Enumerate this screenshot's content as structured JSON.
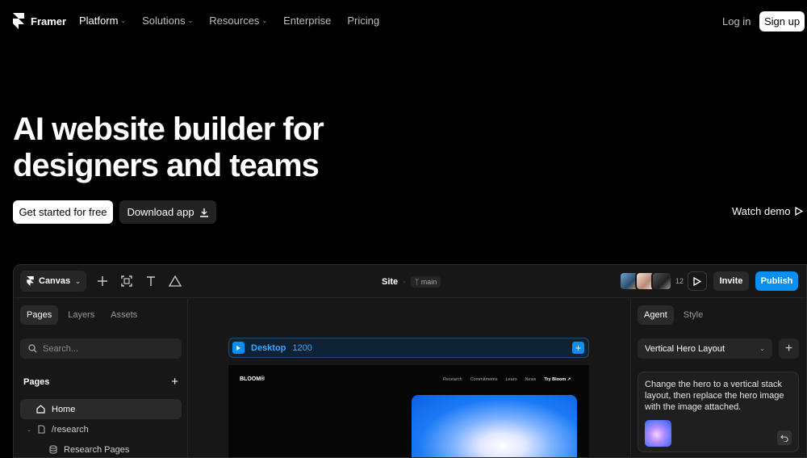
{
  "nav": {
    "brand": "Framer",
    "links": [
      {
        "label": "Platform",
        "has_dropdown": true
      },
      {
        "label": "Solutions",
        "has_dropdown": true
      },
      {
        "label": "Resources",
        "has_dropdown": true
      },
      {
        "label": "Enterprise",
        "has_dropdown": false
      },
      {
        "label": "Pricing",
        "has_dropdown": false
      }
    ],
    "login": "Log in",
    "signup": "Sign up"
  },
  "hero": {
    "title_line1": "AI website builder for",
    "title_line2": "designers and teams",
    "cta_primary": "Get started for free",
    "cta_secondary": "Download app",
    "watch_demo": "Watch demo"
  },
  "app": {
    "toolbar": {
      "canvas_label": "Canvas",
      "site_label": "Site",
      "site_separator": "·",
      "branch": "main",
      "collaborator_count": "12",
      "invite": "Invite",
      "publish": "Publish"
    },
    "left": {
      "tabs": [
        "Pages",
        "Layers",
        "Assets"
      ],
      "active_tab": "Pages",
      "search_placeholder": "Search...",
      "pages_heading": "Pages",
      "pages": [
        "Home",
        "/research",
        "Research Pages"
      ]
    },
    "canvas": {
      "frame_label": "Desktop",
      "frame_width": "1200",
      "preview": {
        "brand": "BLOOM®",
        "links": [
          "Research",
          "Commitments",
          "Learn",
          "News"
        ],
        "cta": "Try Bloom ↗"
      }
    },
    "right": {
      "tabs": [
        "Agent",
        "Style"
      ],
      "active_tab": "Agent",
      "layout_select": "Vertical Hero Layout",
      "message": "Change the hero to a vertical stack layout, then replace the hero image with the image attached."
    }
  },
  "colors": {
    "background": "#000000",
    "accent": "#0a8ef0",
    "panel": "#171717"
  }
}
